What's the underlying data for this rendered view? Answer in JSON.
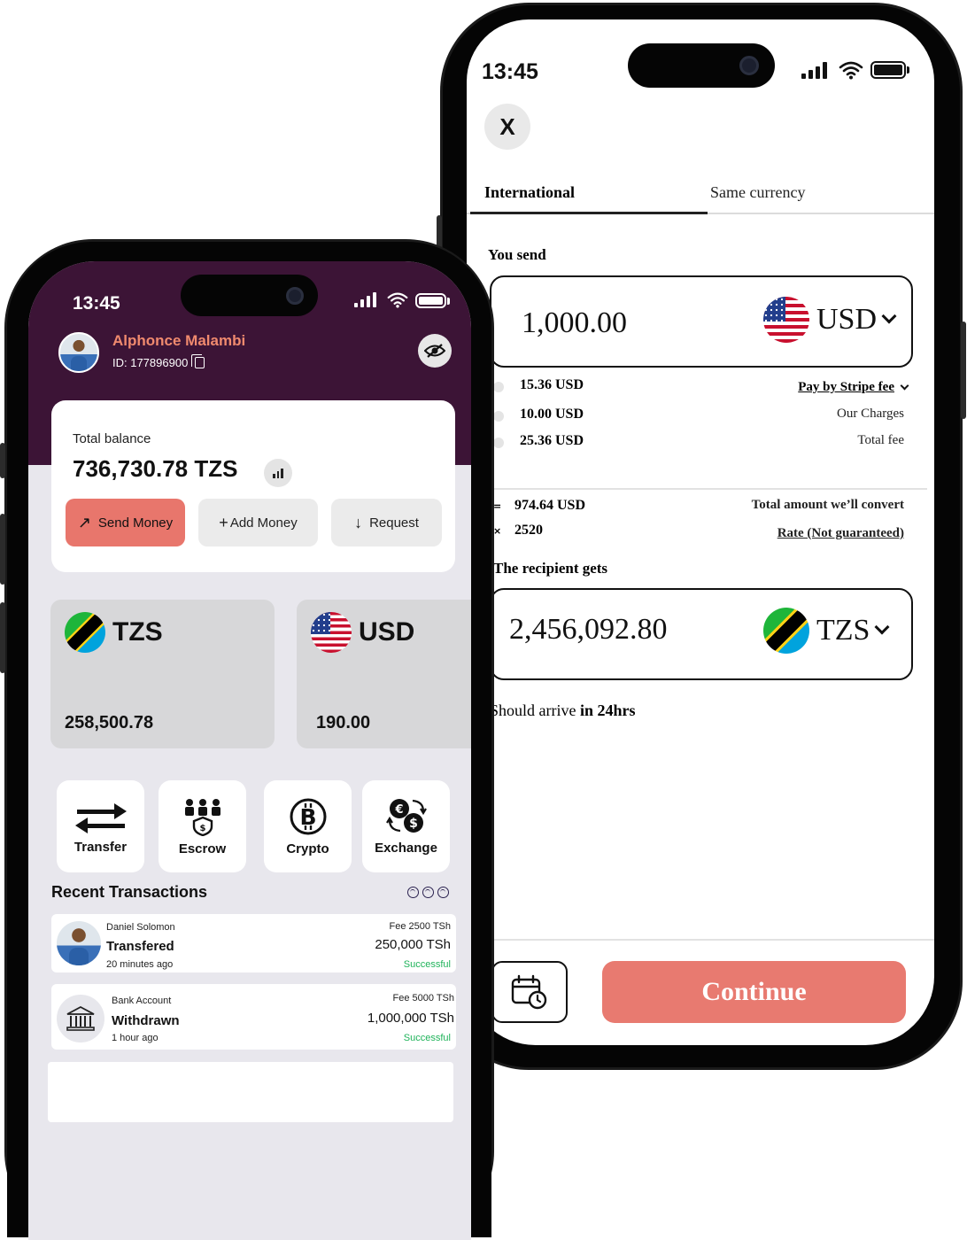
{
  "colors": {
    "brand_purple": "#3c1436",
    "accent_coral": "#e8766c",
    "success_green": "#1fb35a",
    "name_orange": "#f08a6e"
  },
  "transfer_screen": {
    "status_bar": {
      "time": "13:45"
    },
    "close_label": "X",
    "tabs": [
      {
        "label": "International",
        "active": true
      },
      {
        "label": "Same currency",
        "active": false
      }
    ],
    "you_send": {
      "label": "You send",
      "amount": "1,000.00",
      "currency": "USD",
      "flag": "us-flag-icon"
    },
    "fees": [
      {
        "amount": "15.36 USD",
        "desc": "Pay by Stripe fee"
      },
      {
        "amount": "10.00 USD",
        "desc": "Our  Charges"
      },
      {
        "amount": "25.36 USD",
        "desc": "Total fee"
      }
    ],
    "convert": {
      "amount": "974.64 USD",
      "label": "Total amount we’ll convert",
      "rate": "2520",
      "rate_label": "Rate (Not guaranteed)"
    },
    "recipient": {
      "label": "The recipient gets",
      "amount": "2,456,092.80",
      "currency": "TZS",
      "flag": "tz-flag-icon"
    },
    "arrival": {
      "prefix": "Should arrive ",
      "value": "in 24hrs"
    },
    "continue_label": "Continue",
    "schedule_icon": "calendar-clock-icon"
  },
  "home_screen": {
    "status_bar": {
      "time": "13:45"
    },
    "user": {
      "name": "Alphonce Malambi",
      "id": "ID: 177896900"
    },
    "balance": {
      "label": "Total balance",
      "value": "736,730.78 TZS"
    },
    "actions": [
      {
        "label": "Send Money",
        "icon": "↗"
      },
      {
        "label": "Add Money",
        "icon": "+"
      },
      {
        "label": "Request",
        "icon": "↓"
      }
    ],
    "wallets": [
      {
        "code": "TZS",
        "amount": "258,500.78",
        "flag": "tz-flag-icon"
      },
      {
        "code": "USD",
        "amount": "190.00",
        "flag": "us-flag-icon"
      }
    ],
    "services": [
      {
        "label": "Transfer",
        "icon": "transfer-arrows-icon"
      },
      {
        "label": "Escrow",
        "icon": "escrow-icon"
      },
      {
        "label": "Crypto",
        "icon": "bitcoin-icon"
      },
      {
        "label": "Exchange",
        "icon": "exchange-icon"
      }
    ],
    "recent_title": "Recent Transactions",
    "transactions": [
      {
        "who": "Daniel Solomon",
        "type": "Transfered",
        "time": "20 minutes ago",
        "fee": "Fee 2500 TSh",
        "amount": "250,000 TSh",
        "status": "Successful"
      },
      {
        "who": "Bank Account",
        "type": "Withdrawn",
        "time": "1 hour ago",
        "fee": "Fee 5000 TSh",
        "amount": "1,000,000 TSh",
        "status": "Successful"
      }
    ]
  }
}
